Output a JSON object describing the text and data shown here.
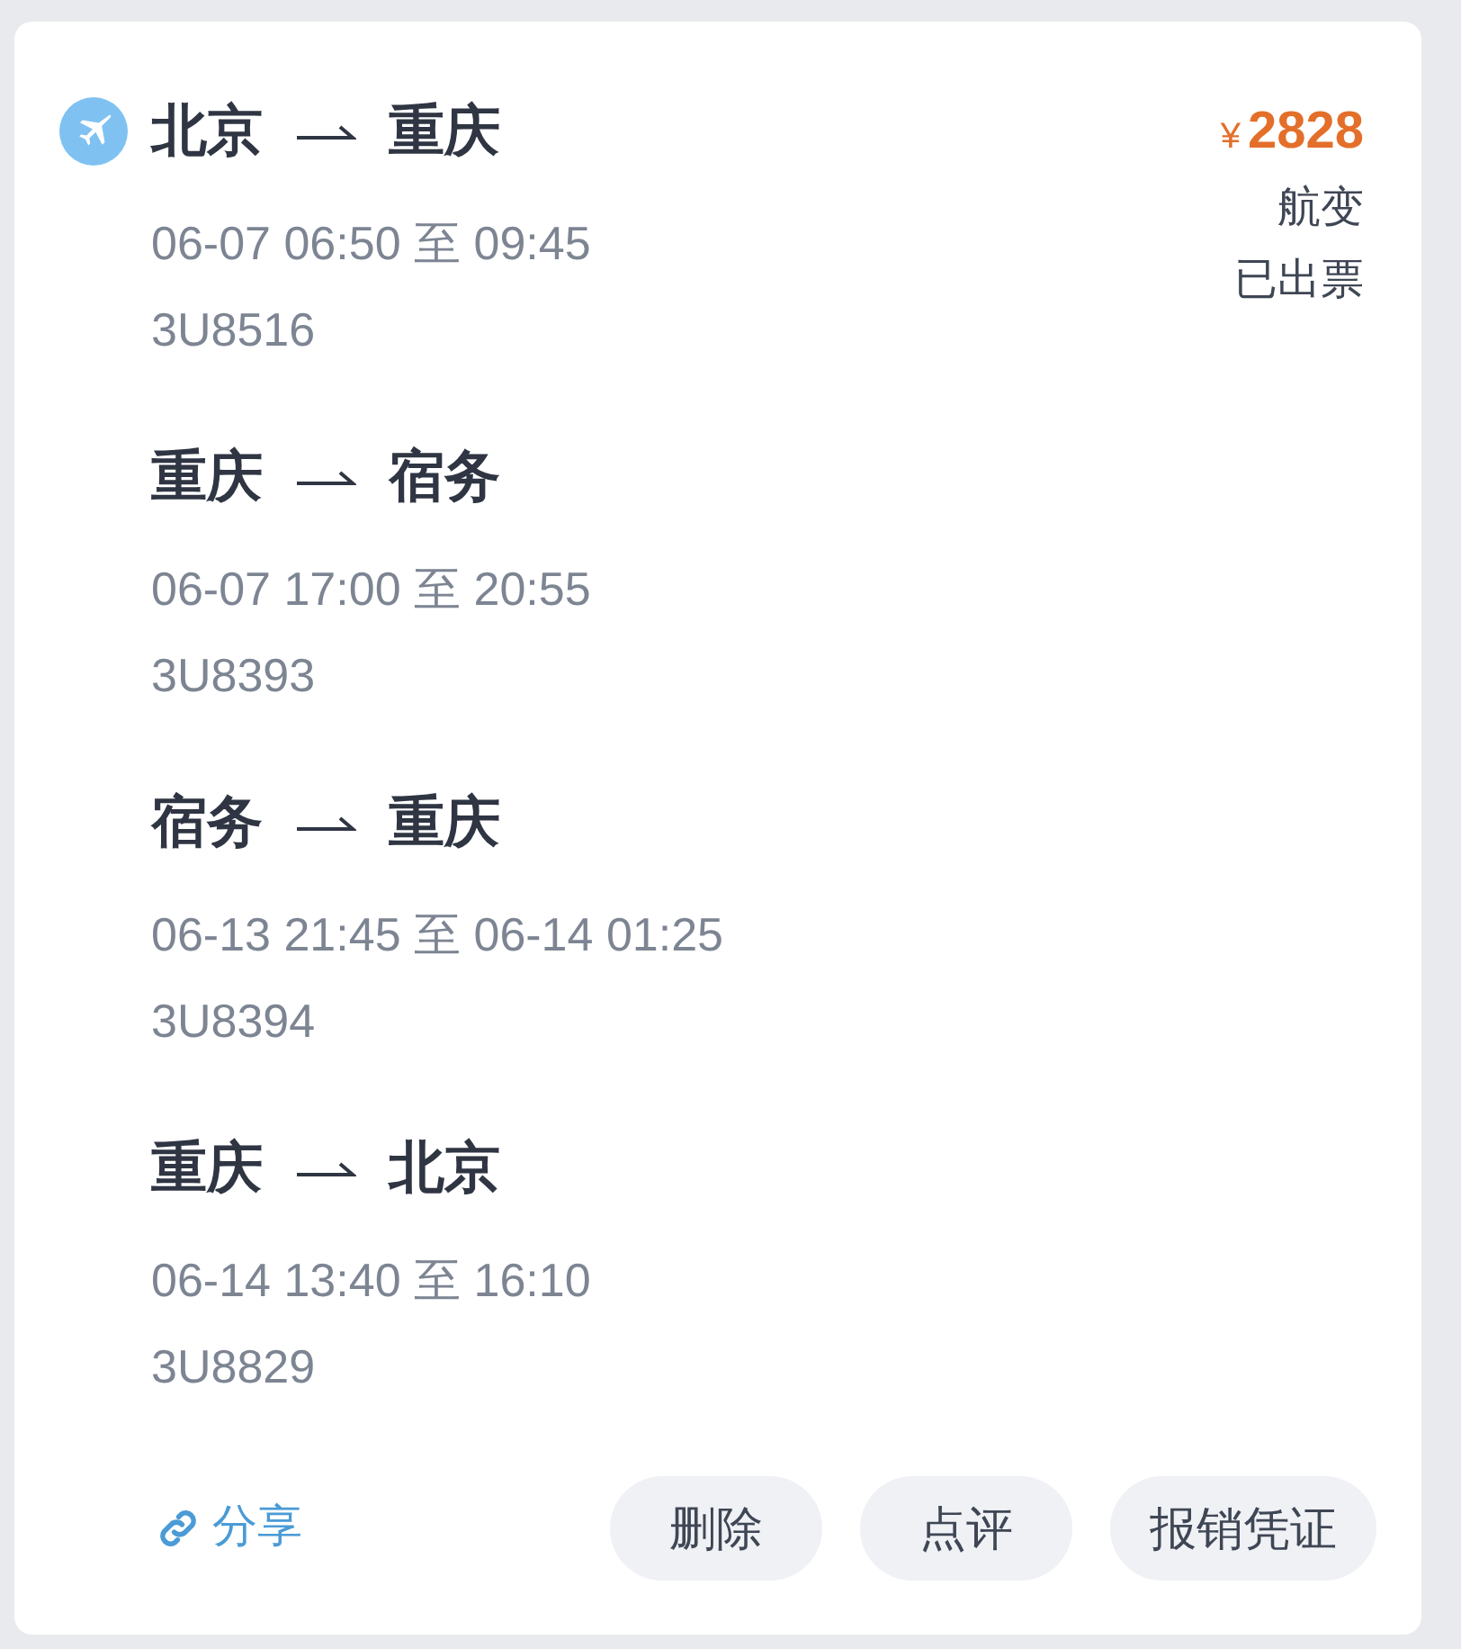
{
  "order": {
    "segments": [
      {
        "from": "北京",
        "to": "重庆",
        "time": "06-07 06:50 至 09:45",
        "flight": "3U8516"
      },
      {
        "from": "重庆",
        "to": "宿务",
        "time": "06-07 17:00 至 20:55",
        "flight": "3U8393"
      },
      {
        "from": "宿务",
        "to": "重庆",
        "time": "06-13 21:45 至 06-14 01:25",
        "flight": "3U8394"
      },
      {
        "from": "重庆",
        "to": "北京",
        "time": "06-14 13:40 至 16:10",
        "flight": "3U8829"
      }
    ],
    "price": {
      "currency": "¥",
      "amount": "2828"
    },
    "statuses": [
      "航变",
      "已出票"
    ],
    "share": "分享",
    "buttons": [
      "删除",
      "点评",
      "报销凭证"
    ]
  }
}
